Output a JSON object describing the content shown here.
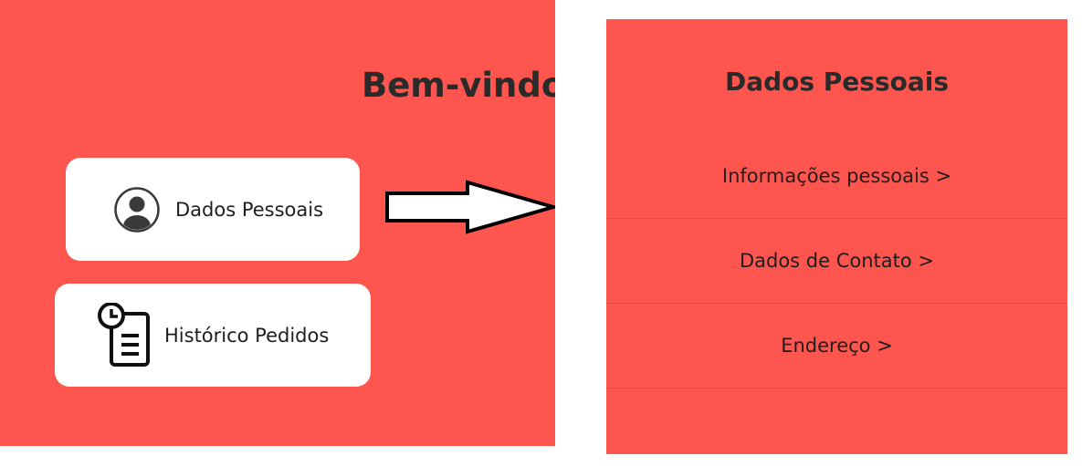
{
  "welcome": {
    "title": "Bem-vindo("
  },
  "cards": {
    "personal": {
      "label": "Dados Pessoais",
      "icon": "user-circle-icon"
    },
    "orders": {
      "label": "Histórico Pedidos",
      "icon": "clock-clipboard-icon"
    }
  },
  "transition": {
    "icon": "arrow-right-icon"
  },
  "personal_screen": {
    "title": "Dados Pessoais",
    "items": [
      {
        "label": "Informações pessoais >"
      },
      {
        "label": "Dados de Contato >"
      },
      {
        "label": "Endereço >"
      }
    ]
  },
  "colors": {
    "accent": "#fe554e",
    "card": "#ffffff",
    "text": "#212529"
  }
}
